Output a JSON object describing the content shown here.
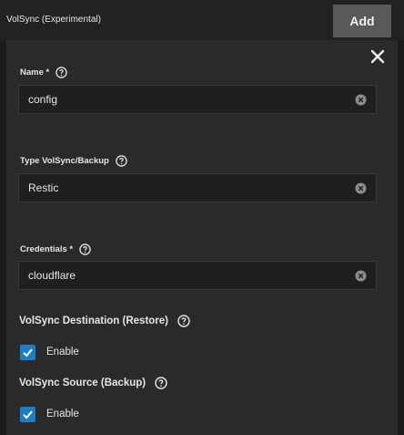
{
  "header": {
    "title": "VolSync (Experimental)",
    "add_label": "Add"
  },
  "form": {
    "name": {
      "label": "Name *",
      "value": "config"
    },
    "type": {
      "label": "Type VolSync/Backup",
      "value": "Restic"
    },
    "credentials": {
      "label": "Credentials *",
      "value": "cloudflare"
    }
  },
  "destination": {
    "title": "VolSync Destination (Restore)",
    "enable_label": "Enable",
    "enabled": true
  },
  "source": {
    "title": "VolSync Source (Backup)",
    "enable_label": "Enable",
    "enabled": true
  },
  "colors": {
    "accent": "#1d7ec8",
    "panel": "#2a2a2a",
    "background": "#1b1b1b",
    "button": "#595959"
  }
}
